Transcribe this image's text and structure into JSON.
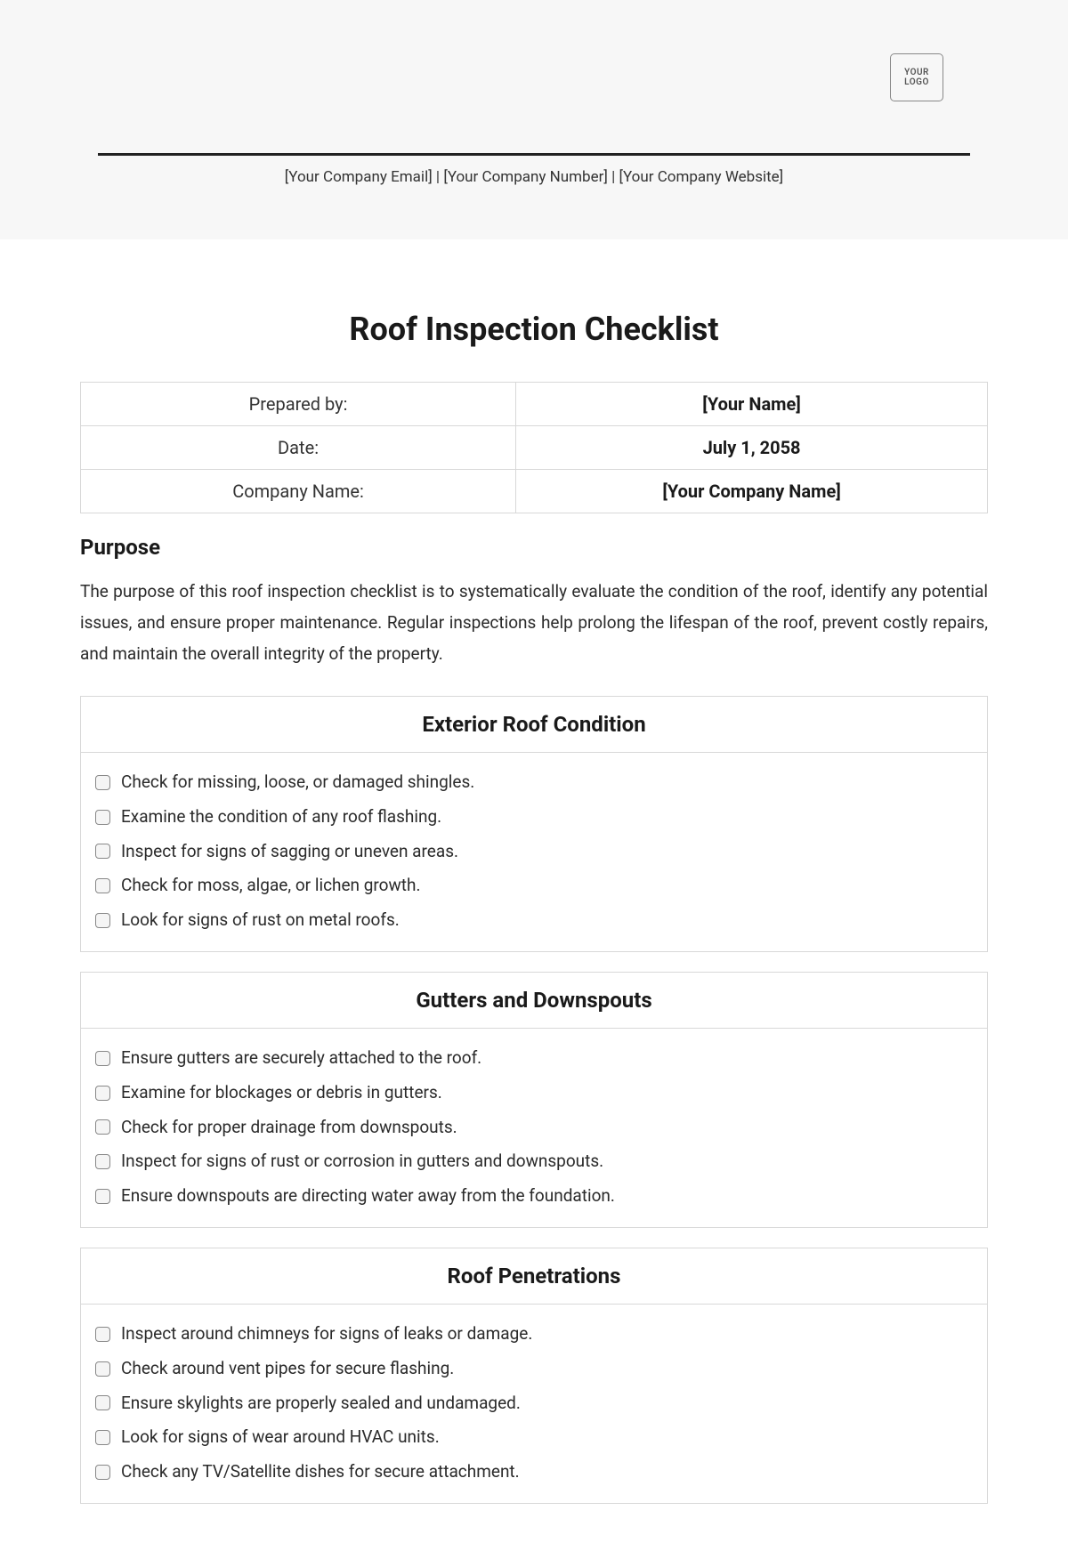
{
  "logo": {
    "line1": "YOUR",
    "line2": "LOGO"
  },
  "contact": {
    "email": "[Your Company Email]",
    "number": "[Your Company Number]",
    "website": "[Your Company Website]",
    "sep": " | "
  },
  "title": "Roof Inspection Checklist",
  "info_table": {
    "rows": [
      {
        "label": "Prepared by:",
        "value": "[Your Name]"
      },
      {
        "label": "Date:",
        "value": "July 1, 2058"
      },
      {
        "label": "Company Name:",
        "value": "[Your Company Name]"
      }
    ]
  },
  "purpose": {
    "heading": "Purpose",
    "text": "The purpose of this roof inspection checklist is to systematically evaluate the condition of the roof, identify any potential issues, and ensure proper maintenance. Regular inspections help prolong the lifespan of the roof, prevent costly repairs, and maintain the overall integrity of the property."
  },
  "sections": [
    {
      "title": "Exterior Roof Condition",
      "items": [
        "Check for missing, loose, or damaged shingles.",
        "Examine the condition of any roof flashing.",
        "Inspect for signs of sagging or uneven areas.",
        "Check for moss, algae, or lichen growth.",
        "Look for signs of rust on metal roofs."
      ]
    },
    {
      "title": "Gutters and Downspouts",
      "items": [
        "Ensure gutters are securely attached to the roof.",
        "Examine for blockages or debris in gutters.",
        "Check for proper drainage from downspouts.",
        "Inspect for signs of rust or corrosion in gutters and downspouts.",
        "Ensure downspouts are directing water away from the foundation."
      ]
    },
    {
      "title": "Roof Penetrations",
      "items": [
        "Inspect around chimneys for signs of leaks or damage.",
        "Check around vent pipes for secure flashing.",
        "Ensure skylights are properly sealed and undamaged.",
        "Look for signs of wear around HVAC units.",
        "Check any TV/Satellite dishes for secure attachment."
      ]
    }
  ]
}
